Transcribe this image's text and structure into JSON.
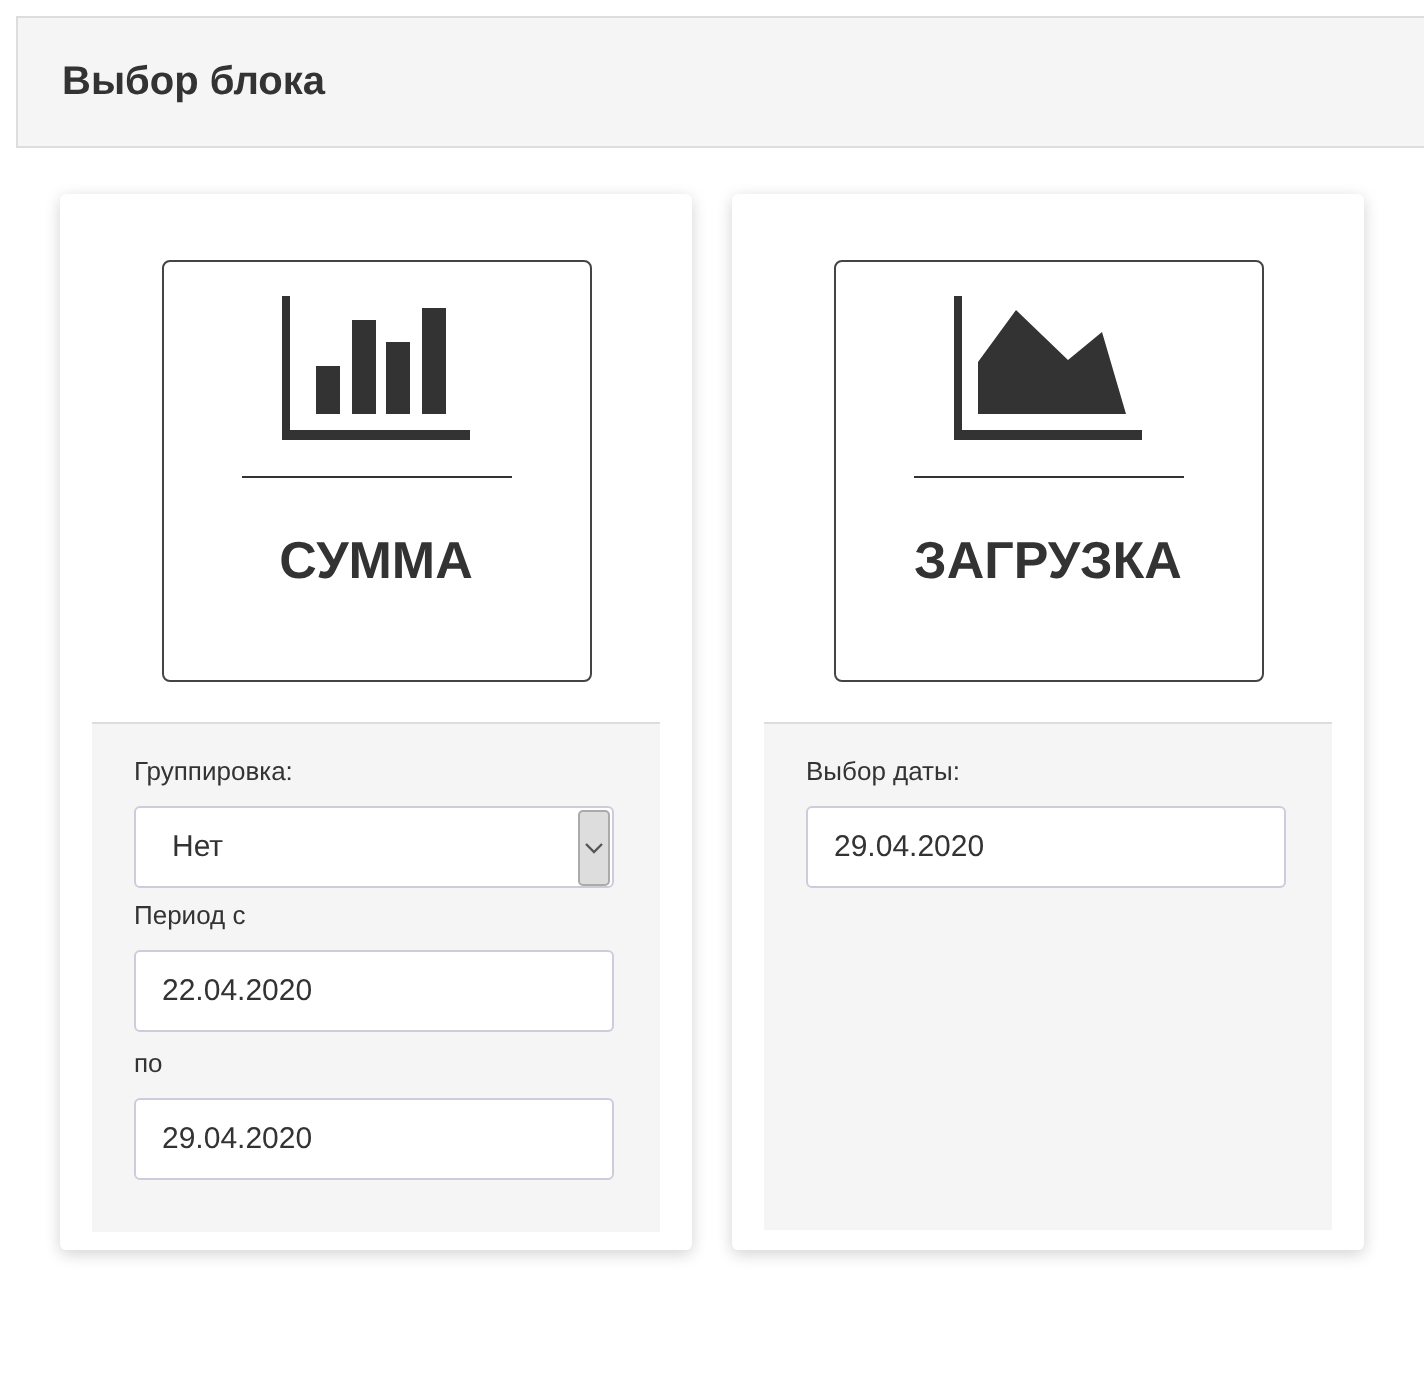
{
  "header": {
    "title": "Выбор блока"
  },
  "blocks": [
    {
      "kind": "bar",
      "title": "СУММА",
      "fields": [
        {
          "kind": "label",
          "text": "Группировка:"
        },
        {
          "kind": "select",
          "value": "Нет"
        },
        {
          "kind": "label",
          "text": "Период с"
        },
        {
          "kind": "input",
          "value": "22.04.2020"
        },
        {
          "kind": "label",
          "text": "по"
        },
        {
          "kind": "input",
          "value": "29.04.2020"
        }
      ]
    },
    {
      "kind": "area",
      "title": "ЗАГРУЗКА",
      "fields": [
        {
          "kind": "label",
          "text": "Выбор даты:"
        },
        {
          "kind": "input",
          "value": "29.04.2020"
        }
      ]
    }
  ]
}
